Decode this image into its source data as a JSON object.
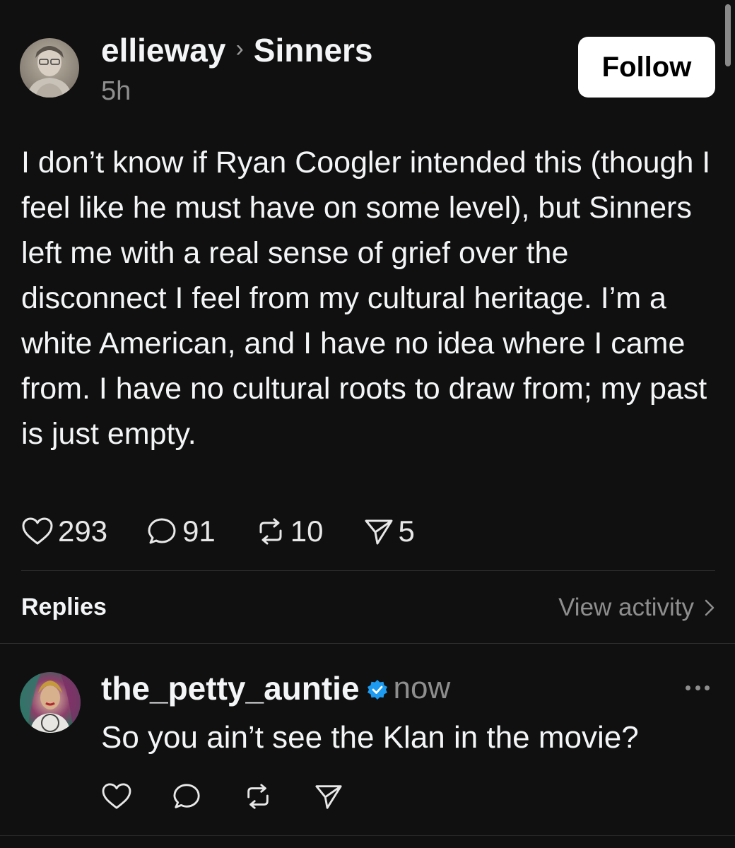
{
  "post": {
    "author": "ellieway",
    "community": "Sinners",
    "time": "5h",
    "follow_label": "Follow",
    "text": "I don’t know if Ryan Coogler intended this (though I feel like he must have on some level), but Sinners left me with a real sense of grief over the disconnect I feel from my cultural heritage. I’m a white American, and I have no idea where I came from. I have no cultural roots to draw from; my past is just empty.",
    "stats": {
      "likes": "293",
      "comments": "91",
      "reposts": "10",
      "shares": "5"
    },
    "icons": [
      "heart-icon",
      "comment-icon",
      "repost-icon",
      "share-icon"
    ]
  },
  "replies_bar": {
    "label": "Replies",
    "view_activity": "View activity"
  },
  "reply": {
    "author": "the_petty_auntie",
    "verified": true,
    "time": "now",
    "text": "So you ain’t see the Klan in the movie?"
  },
  "colors": {
    "background": "#101010",
    "text": "#f3f5f7",
    "muted": "#8e8e8e",
    "verified": "#1d9bf0",
    "follow_bg": "#ffffff"
  }
}
